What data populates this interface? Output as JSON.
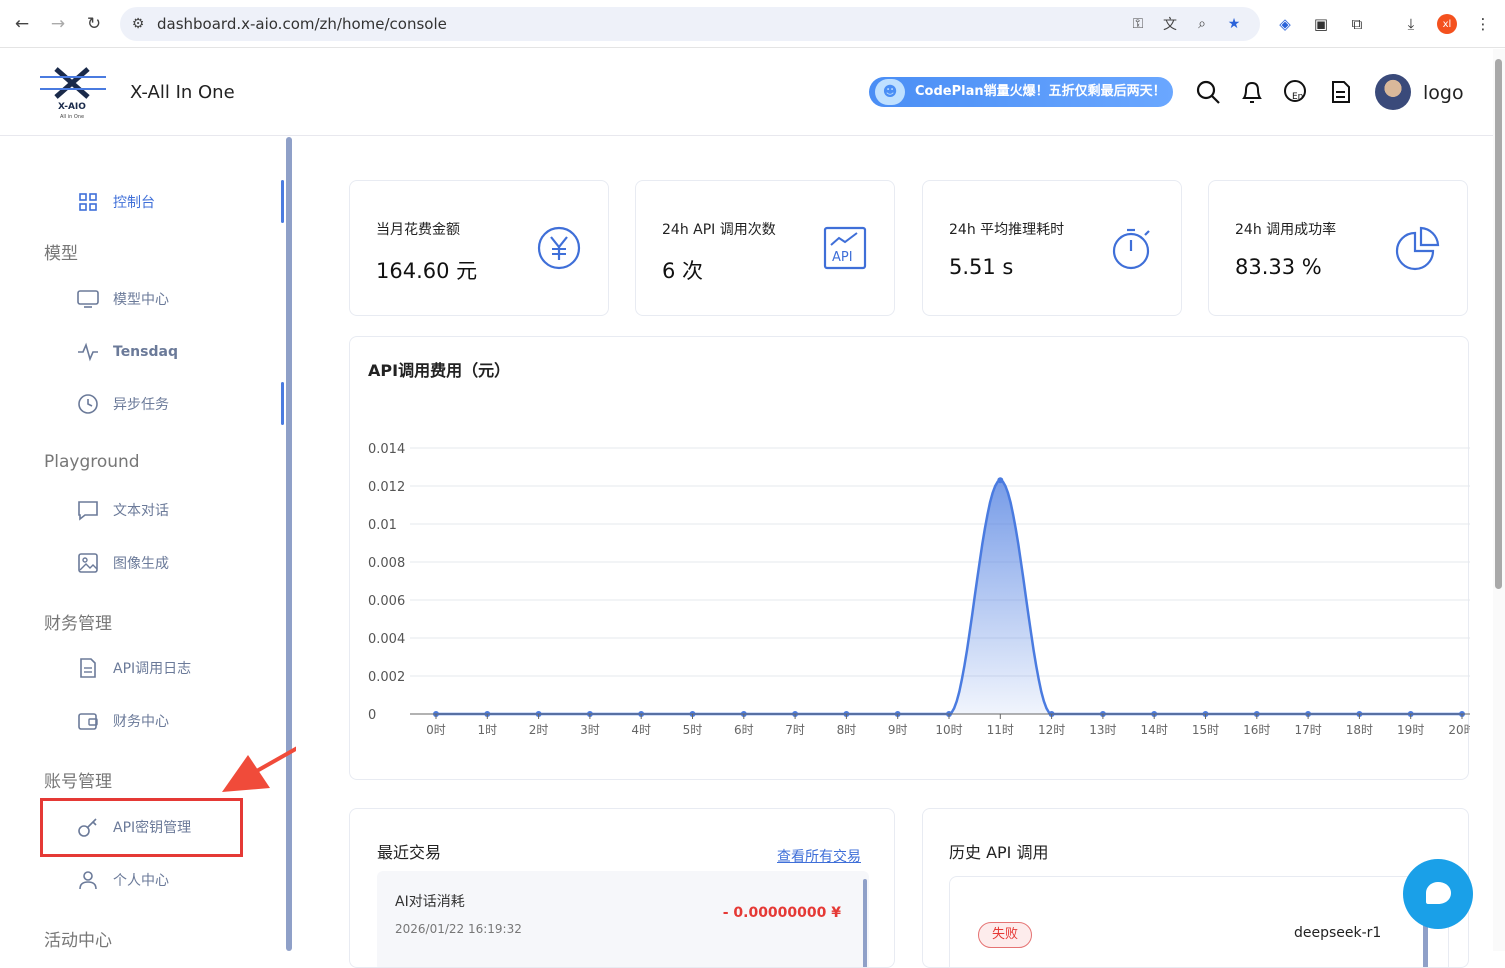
{
  "browser": {
    "url": "dashboard.x-aio.com/zh/home/console",
    "profile_initial": "xl"
  },
  "header": {
    "logo_text": "X-AIO",
    "logo_subtext": "All in One",
    "brand_name": "X-All In One",
    "promo_text": "CodePlan销量火爆！五折仅剩最后两天！",
    "user_name": "logo"
  },
  "sidebar": {
    "console": "控制台",
    "group_model": "模型",
    "model_center": "模型中心",
    "tensdaq": "Tensdaq",
    "async_tasks": "异步任务",
    "group_playground": "Playground",
    "text_chat": "文本对话",
    "image_gen": "图像生成",
    "group_finance": "财务管理",
    "api_log": "API调用日志",
    "finance_center": "财务中心",
    "group_account": "账号管理",
    "api_keys": "API密钥管理",
    "personal_center": "个人中心",
    "group_activity": "活动中心"
  },
  "stats": [
    {
      "label": "当月花费金额",
      "value": "164.60 元",
      "icon": "yen-icon"
    },
    {
      "label": "24h API 调用次数",
      "value": "6 次",
      "icon": "api-chart-icon"
    },
    {
      "label": "24h 平均推理耗时",
      "value": "5.51 s",
      "icon": "stopwatch-icon"
    },
    {
      "label": "24h 调用成功率",
      "value": "83.33 %",
      "icon": "pie-icon"
    }
  ],
  "chart_data": {
    "type": "area",
    "title": "API调用费用（元）",
    "categories": [
      "0时",
      "1时",
      "2时",
      "3时",
      "4时",
      "5时",
      "6时",
      "7时",
      "8时",
      "9时",
      "10时",
      "11时",
      "12时",
      "13时",
      "14时",
      "15时",
      "16时",
      "17时",
      "18时",
      "19时",
      "20时"
    ],
    "values": [
      0,
      0,
      0,
      0,
      0,
      0,
      0,
      0,
      0,
      0,
      0,
      0.0123,
      0,
      0,
      0,
      0,
      0,
      0,
      0,
      0,
      0
    ],
    "ylim": [
      0,
      0.014
    ],
    "yticks": [
      "0",
      "0.002",
      "0.004",
      "0.006",
      "0.008",
      "0.01",
      "0.012",
      "0.014"
    ],
    "grid": true,
    "color": "#4a7be0"
  },
  "transactions": {
    "title": "最近交易",
    "view_all": "查看所有交易",
    "items": [
      {
        "name": "AI对话消耗",
        "time": "2026/01/22 16:19:32",
        "amount": "- 0.00000000 ¥"
      }
    ]
  },
  "history": {
    "title": "历史 API 调用",
    "items": [
      {
        "status": "失败",
        "model": "deepseek-r1"
      }
    ]
  },
  "colors": {
    "accent": "#3f6fd8",
    "danger": "#e53935",
    "chat": "#1aa0e8"
  }
}
